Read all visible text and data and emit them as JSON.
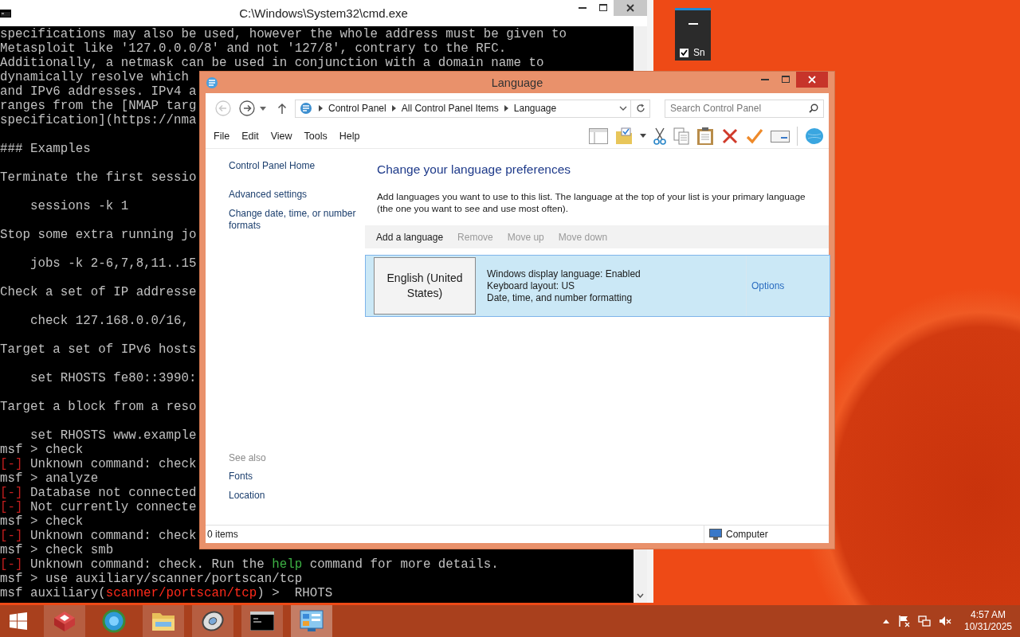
{
  "cmd_window": {
    "title": "C:\\Windows\\System32\\cmd.exe",
    "console_blocks": [
      [
        "specifications may also be used, however the whole address must be given to",
        "Metasploit like '127.0.0.0/8' and not '127/8', contrary to the RFC.",
        "Additionally, a netmask can be used in conjunction with a domain name to",
        "dynamically resolve which",
        "and IPv6 addresses. IPv4 a",
        "ranges from the [NMAP targ",
        "specification](https://nma"
      ],
      [
        "### Examples"
      ],
      [
        "Terminate the first sessio"
      ],
      [
        "    sessions -k 1"
      ],
      [
        "Stop some extra running jo"
      ],
      [
        "    jobs -k 2-6,7,8,11..15"
      ],
      [
        "Check a set of IP addresse"
      ],
      [
        "    check 127.168.0.0/16,"
      ],
      [
        "Target a set of IPv6 hosts"
      ],
      [
        "    set RHOSTS fe80::3990:"
      ],
      [
        "Target a block from a reso"
      ],
      [
        "    set RHOSTS www.example",
        "msf > check",
        {
          "spans": [
            {
              "text": "[-]",
              "color": "#c41e1e"
            },
            {
              "text": " Unknown command: check"
            }
          ]
        },
        "msf > analyze",
        {
          "spans": [
            {
              "text": "[-]",
              "color": "#c41e1e"
            },
            {
              "text": " Database not connected"
            }
          ]
        },
        {
          "spans": [
            {
              "text": "[-]",
              "color": "#c41e1e"
            },
            {
              "text": " Not currently connecte"
            }
          ]
        },
        "msf > check",
        {
          "spans": [
            {
              "text": "[-]",
              "color": "#c41e1e"
            },
            {
              "text": " Unknown command: check"
            }
          ]
        },
        "msf > check smb",
        {
          "spans": [
            {
              "text": "[-]",
              "color": "#c41e1e"
            },
            {
              "text": " Unknown command: check. Run the "
            },
            {
              "text": "help",
              "color": "#3cb043"
            },
            {
              "text": " command for more details."
            }
          ]
        },
        "msf > use auxiliary/scanner/portscan/tcp",
        {
          "spans": [
            {
              "text": "msf auxiliary("
            },
            {
              "text": "scanner/portscan/tcp",
              "color": "#ff2a1a"
            },
            {
              "text": ") >  RHOTS"
            }
          ]
        }
      ]
    ]
  },
  "mini_window": {
    "checkbox_label": "Sn",
    "checked": true
  },
  "language_window": {
    "title": "Language",
    "breadcrumbs": [
      "Control Panel",
      "All Control Panel Items",
      "Language"
    ],
    "search": {
      "placeholder": "Search Control Panel"
    },
    "menu": [
      "File",
      "Edit",
      "View",
      "Tools",
      "Help"
    ],
    "sidebar": {
      "links": [
        "Control Panel Home",
        "Advanced settings",
        "Change date, time, or number formats"
      ],
      "see_also_heading": "See also",
      "see_also": [
        "Fonts",
        "Location"
      ]
    },
    "heading": "Change your language preferences",
    "description": "Add languages you want to use to this list. The language at the top of your list is your primary language (the one you want to see and use most often).",
    "commands": [
      {
        "label": "Add a language",
        "disabled": false
      },
      {
        "label": "Remove",
        "disabled": true
      },
      {
        "label": "Move up",
        "disabled": true
      },
      {
        "label": "Move down",
        "disabled": true
      }
    ],
    "languages": [
      {
        "name": "English (United States)",
        "details": [
          "Windows display language: Enabled",
          "Keyboard layout: US",
          "Date, time, and number formatting"
        ],
        "options": "Options",
        "selected": true
      }
    ],
    "status": {
      "items": "0 items",
      "location": "Computer"
    }
  },
  "taskbar": {
    "apps": [
      {
        "kind": "cube",
        "running": true,
        "active": false
      },
      {
        "kind": "browser",
        "running": false,
        "active": false
      },
      {
        "kind": "folder",
        "running": true,
        "active": false
      },
      {
        "kind": "disc",
        "running": true,
        "active": false
      },
      {
        "kind": "terminal",
        "running": true,
        "active": false
      },
      {
        "kind": "panel",
        "running": true,
        "active": true
      }
    ],
    "clock": {
      "time": "4:57 AM",
      "date": "10/31/2025"
    }
  }
}
